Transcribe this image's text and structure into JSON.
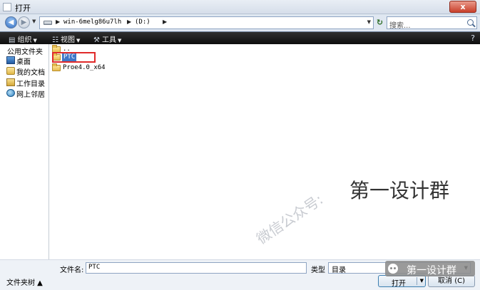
{
  "window": {
    "title": "打开",
    "close_glyph": "x"
  },
  "address": {
    "back_glyph": "◀",
    "forward_glyph": "▶",
    "crumbs": [
      "win-6melg86u7lh",
      "(D:)"
    ],
    "search_placeholder": "搜索..."
  },
  "toolbar": {
    "organize": "组织",
    "views": "视图",
    "tools": "工具"
  },
  "sidebar": {
    "header": "公用文件夹",
    "items": [
      {
        "label": "桌面",
        "icon": "desktop-icon"
      },
      {
        "label": "我的文档",
        "icon": "documents-icon"
      },
      {
        "label": "工作目录",
        "icon": "working-dir-icon"
      },
      {
        "label": "网上邻居",
        "icon": "network-icon"
      }
    ]
  },
  "files": [
    {
      "name": ".."
    },
    {
      "name": "PTC",
      "selected": true
    },
    {
      "name": "Proe4.0_x64"
    }
  ],
  "bottom": {
    "filename_label": "文件名:",
    "filename_value": "PTC",
    "type_label": "类型",
    "type_value": "目录",
    "folders_toggle": "文件夹树 ▲",
    "open_label": "打开",
    "cancel_label": "取消 (C)"
  },
  "watermark": {
    "main": "第一设计群",
    "diagonal": "微信公众号:",
    "badge": "第一设计群"
  },
  "colors": {
    "accent": "#3f77c8",
    "highlight": "#e02a2a",
    "toolbar_bg": "#1a1a1a"
  }
}
